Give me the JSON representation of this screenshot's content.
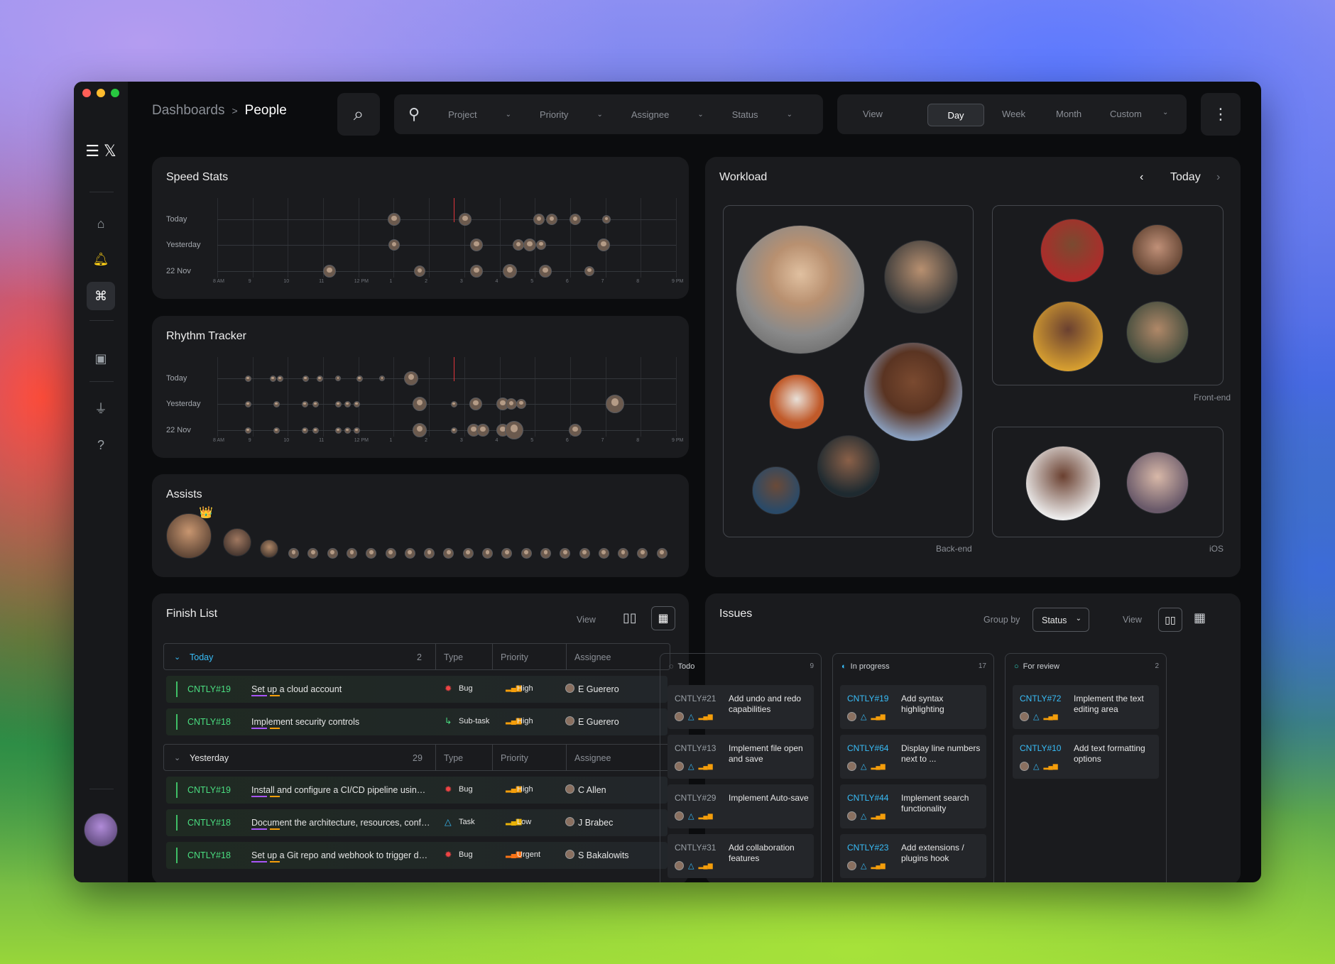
{
  "breadcrumb": {
    "parent": "Dashboards",
    "sep": ">",
    "current": "People"
  },
  "filters": {
    "project": "Project",
    "priority": "Priority",
    "assignee": "Assignee",
    "status": "Status"
  },
  "view": {
    "label": "View",
    "options": [
      "Day",
      "Week",
      "Month",
      "Custom"
    ],
    "selected": "Day"
  },
  "speed": {
    "title": "Speed Stats",
    "rows": [
      "Today",
      "Yesterday",
      "22 Nov"
    ]
  },
  "rhythm": {
    "title": "Rhythm Tracker",
    "rows": [
      "Today",
      "Yesterday",
      "22 Nov"
    ]
  },
  "ticks": [
    "8 AM",
    "9",
    "10",
    "11",
    "12 PM",
    "1",
    "2",
    "3",
    "4",
    "5",
    "6",
    "7",
    "8",
    "9 PM"
  ],
  "assists": {
    "title": "Assists",
    "crown": "👑"
  },
  "workload": {
    "title": "Workload",
    "period": "Today",
    "groups": [
      "Back-end",
      "Front-end",
      "iOS"
    ]
  },
  "finish": {
    "title": "Finish List",
    "view_label": "View",
    "cols": {
      "type": "Type",
      "priority": "Priority",
      "assignee": "Assignee"
    },
    "groups": [
      {
        "name": "Today",
        "count": "2",
        "rows": [
          {
            "id": "CNTLY#19",
            "title": "Set up a cloud account",
            "type": "Bug",
            "priority": "High",
            "assignee": "E Guerero"
          },
          {
            "id": "CNTLY#18",
            "title": "Implement security controls",
            "type": "Sub-task",
            "priority": "High",
            "assignee": "E Guerero"
          }
        ]
      },
      {
        "name": "Yesterday",
        "count": "29",
        "rows": [
          {
            "id": "CNTLY#19",
            "title": "Install and configure a CI/CD pipeline using to...",
            "type": "Bug",
            "priority": "High",
            "assignee": "C Allen"
          },
          {
            "id": "CNTLY#18",
            "title": "Document the architecture, resources, config...",
            "type": "Task",
            "priority": "Low",
            "assignee": "J Brabec"
          },
          {
            "id": "CNTLY#18",
            "title": "Set up a Git repo and webhook to trigger de...",
            "type": "Bug",
            "priority": "Urgent",
            "assignee": "S Bakalowits"
          }
        ]
      }
    ]
  },
  "issues": {
    "title": "Issues",
    "group_by_label": "Group by",
    "group_by_value": "Status",
    "view_label": "View",
    "columns": [
      {
        "name": "Todo",
        "count": "9",
        "cards": [
          {
            "id": "CNTLY#21",
            "title": "Add undo and redo capabilities"
          },
          {
            "id": "CNTLY#13",
            "title": "Implement file open and save"
          },
          {
            "id": "CNTLY#29",
            "title": "Implement Auto-save"
          },
          {
            "id": "CNTLY#31",
            "title": "Add collaboration features"
          }
        ]
      },
      {
        "name": "In progress",
        "count": "17",
        "cards": [
          {
            "id": "CNTLY#19",
            "title": "Add syntax highlighting"
          },
          {
            "id": "CNTLY#64",
            "title": "Display line numbers next to ..."
          },
          {
            "id": "CNTLY#44",
            "title": "Implement search functionality"
          },
          {
            "id": "CNTLY#23",
            "title": "Add extensions / plugins hook"
          }
        ]
      },
      {
        "name": "For review",
        "count": "2",
        "cards": [
          {
            "id": "CNTLY#72",
            "title": "Implement the text editing area"
          },
          {
            "id": "CNTLY#10",
            "title": "Add text formatting options"
          }
        ]
      }
    ]
  },
  "colors": {
    "accent_green": "#4ade80",
    "accent_blue": "#38bdf8",
    "now_line": "#e0353b"
  }
}
